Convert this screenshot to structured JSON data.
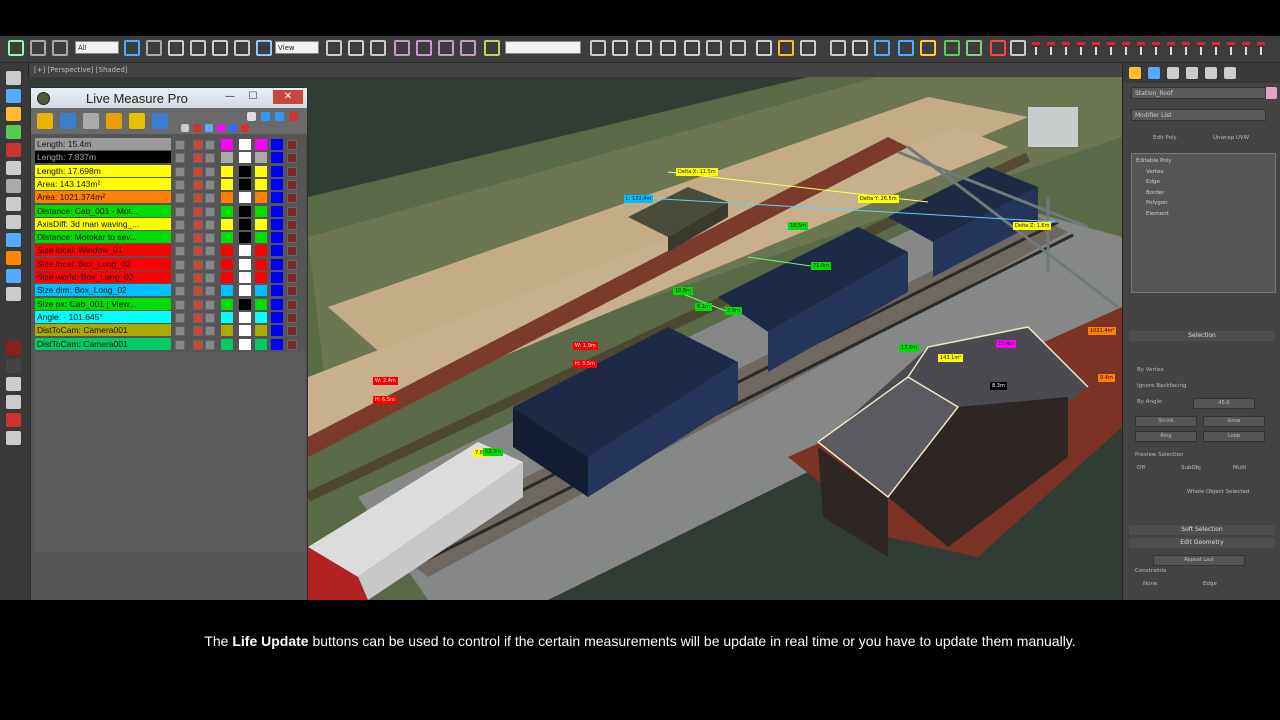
{
  "caption": {
    "bold": "Life Update",
    "before": "The ",
    "after": " buttons can be used to control if the certain measurements will be update in real time or you have to update them manually."
  },
  "toolbar": {
    "selection_filter": "All",
    "ref_coord": "View"
  },
  "viewport": {
    "label": "[+] [Perspective] [Shaded]"
  },
  "panel": {
    "title": "Live Measure Pro",
    "minimize": "—",
    "maximize": "☐",
    "close": "✕",
    "rows": [
      {
        "label": "Length: 15.4m",
        "bg": "#9a9a9a",
        "fg": "#111",
        "sw": [
          "#ff00ff",
          "#ffffff",
          "#ff00ff",
          "#0000ff"
        ]
      },
      {
        "label": "Length: 7.837m",
        "bg": "#000000",
        "fg": "#aaa",
        "sw": [
          "#aaaaaa",
          "#ffffff",
          "#aaaaaa",
          "#0000ff"
        ]
      },
      {
        "label": "Length: 17.698m",
        "bg": "#ffff00",
        "fg": "#111",
        "sw": [
          "#ffff00",
          "#000000",
          "#ffff00",
          "#0000ff"
        ]
      },
      {
        "label": "Area: 143.143m²",
        "bg": "#ffff00",
        "fg": "#111",
        "sw": [
          "#ffff00",
          "#000000",
          "#ffff00",
          "#0000ff"
        ]
      },
      {
        "label": "Area: 1021.374m²",
        "bg": "#ff8000",
        "fg": "#111",
        "sw": [
          "#ff8000",
          "#ffffff",
          "#ff8000",
          "#0000ff"
        ]
      },
      {
        "label": "Distance: Cab_001 - Mot...",
        "bg": "#00dd00",
        "fg": "#111",
        "sw": [
          "#00dd00",
          "#000000",
          "#00dd00",
          "#0000ff"
        ]
      },
      {
        "label": "AxisDiff: 3d man waving_...",
        "bg": "#ffff00",
        "fg": "#111",
        "sw": [
          "#ffff00",
          "#000000",
          "#ffff00",
          "#0000ff"
        ]
      },
      {
        "label": "Distance: Motokar to sev...",
        "bg": "#00dd00",
        "fg": "#111",
        "sw": [
          "#00dd00",
          "#000000",
          "#00dd00",
          "#0000ff"
        ]
      },
      {
        "label": "Size local: Window_01",
        "bg": "#ff0000",
        "fg": "#111",
        "sw": [
          "#ff0000",
          "#ffffff",
          "#ff0000",
          "#0000ff"
        ]
      },
      {
        "label": "Size local: Box_Long_02",
        "bg": "#ff0000",
        "fg": "#111",
        "sw": [
          "#ff0000",
          "#ffffff",
          "#ff0000",
          "#0000ff"
        ]
      },
      {
        "label": "Size world: Box_Long_02",
        "bg": "#ff0000",
        "fg": "#111",
        "sw": [
          "#ff0000",
          "#ffffff",
          "#ff0000",
          "#0000ff"
        ]
      },
      {
        "label": "Size dim: Box_Long_02",
        "bg": "#00c0ff",
        "fg": "#111",
        "sw": [
          "#00c0ff",
          "#ffffff",
          "#00c0ff",
          "#0000ff"
        ]
      },
      {
        "label": "Size px: Cab_001 [ View...",
        "bg": "#00dd00",
        "fg": "#111",
        "sw": [
          "#00dd00",
          "#000000",
          "#00dd00",
          "#0000ff"
        ]
      },
      {
        "label": "Angle: - 101.645°",
        "bg": "#00ffff",
        "fg": "#111",
        "sw": [
          "#00ffff",
          "#ffffff",
          "#00ffff",
          "#0000ff"
        ]
      },
      {
        "label": "DistToCam: Camera001",
        "bg": "#aaaa00",
        "fg": "#111",
        "sw": [
          "#aaaa00",
          "#ffffff",
          "#aaaa00",
          "#0000ff"
        ]
      },
      {
        "label": "DistToCam: Camera001",
        "bg": "#00cc66",
        "fg": "#111",
        "sw": [
          "#00cc66",
          "#ffffff",
          "#00cc66",
          "#0000ff"
        ]
      }
    ]
  },
  "tags": [
    {
      "text": "Delta X: 11.5m",
      "bg": "#ffff00"
    },
    {
      "text": "L: 122.4m",
      "bg": "#00c0ff"
    },
    {
      "text": "Delta Y: 26.5m",
      "bg": "#ffff00"
    },
    {
      "text": "Delta Z: 1.6m",
      "bg": "#ffff00"
    },
    {
      "text": "18.5m",
      "bg": "#00dd00"
    },
    {
      "text": "21.9m",
      "bg": "#00dd00"
    },
    {
      "text": "10.6m",
      "bg": "#00dd00"
    },
    {
      "text": "6.1m",
      "bg": "#00dd00"
    },
    {
      "text": "3.9m",
      "bg": "#00dd00"
    },
    {
      "text": "W: 2.4m",
      "bg": "#ff0000"
    },
    {
      "text": "H: 6.5m",
      "bg": "#ff0000"
    },
    {
      "text": "W: 1.9m",
      "bg": "#ff0000"
    },
    {
      "text": "H: 3.5m",
      "bg": "#ff0000"
    },
    {
      "text": "7.8m",
      "bg": "#ffff00"
    },
    {
      "text": "143.1m²",
      "bg": "#ffff00"
    },
    {
      "text": "15.4m",
      "bg": "#ff00ff"
    },
    {
      "text": "52.3m",
      "bg": "#00dd00"
    },
    {
      "text": "17.6m",
      "bg": "#00dd00"
    },
    {
      "text": "1021.4m²",
      "bg": "#ff8000"
    },
    {
      "text": "9.4m",
      "bg": "#ff8000"
    },
    {
      "text": "8.3m",
      "bg": "#000000"
    }
  ],
  "cmdpanel": {
    "object_name": "Station_Roof",
    "modifier_list": "Modifier List",
    "tab_edit": "Edit Poly",
    "tab_unwrap": "Unwrap UVW",
    "stack": [
      "Editable Poly",
      "Vertex",
      "Edge",
      "Border",
      "Polygon",
      "Element"
    ],
    "selection_head": "Selection",
    "by_vertex": "By Vertex",
    "ignore_backfacing": "Ignore Backfacing",
    "by_angle": "By Angle:",
    "by_angle_val": "45.0",
    "shrink": "Shrink",
    "grow": "Grow",
    "ring": "Ring",
    "loop": "Loop",
    "preview_selection": "Preview Selection",
    "opt_off": "Off",
    "opt_subobj": "SubObj",
    "opt_multi": "Multi",
    "whole_selected": "Whole Object Selected",
    "soft_selection": "Soft Selection",
    "edit_geometry": "Edit Geometry",
    "repeat_last": "Repeat Last",
    "constraints": "Constraints",
    "c_none": "None",
    "c_edge": "Edge"
  }
}
